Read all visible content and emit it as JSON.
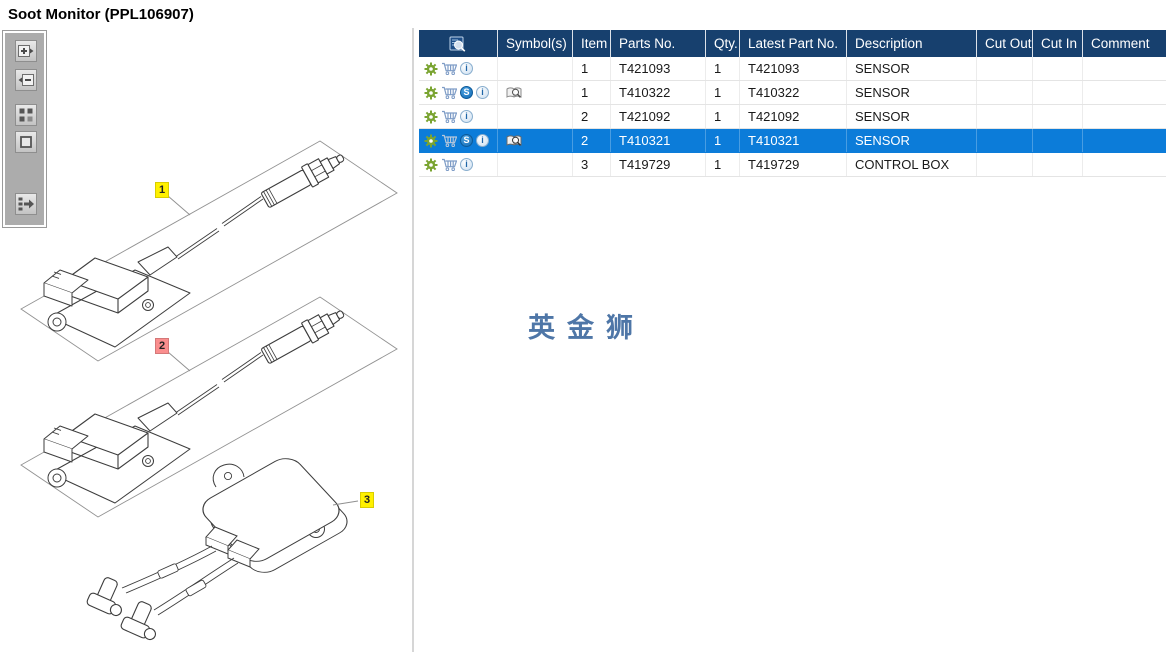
{
  "window": {
    "title": "Soot Monitor (PPL106907)"
  },
  "watermark": {
    "text": "英金狮",
    "color": "#4E76A7"
  },
  "toolbar": {
    "buttons": [
      {
        "name": "zoom-in"
      },
      {
        "name": "zoom-out"
      },
      {
        "name": "tile-view"
      },
      {
        "name": "fit-view"
      },
      {
        "name": "toggle-panel"
      }
    ]
  },
  "diagram": {
    "labels": [
      {
        "text": "1",
        "highlight": "#FFF100",
        "state": "normal"
      },
      {
        "text": "2",
        "highlight": "#FA8E8E",
        "state": "selected"
      },
      {
        "text": "3",
        "highlight": "#FFF100",
        "state": "normal"
      }
    ]
  },
  "table": {
    "columns": [
      "",
      "Symbol(s)",
      "Item",
      "Parts No.",
      "Qty.",
      "Latest Part No.",
      "Description",
      "Cut Out",
      "Cut In",
      "Comment"
    ],
    "icon_labels": {
      "substitute": "S",
      "info": "i"
    },
    "selected_row_index": 3,
    "rows": [
      {
        "item": "1",
        "parts_no": "T421093",
        "qty": "1",
        "latest_part_no": "T421093",
        "description": "SENSOR",
        "cut_out": "",
        "cut_in": "",
        "comment": "",
        "has_substitute": false,
        "has_symbol": false,
        "selected": false
      },
      {
        "item": "1",
        "parts_no": "T410322",
        "qty": "1",
        "latest_part_no": "T410322",
        "description": "SENSOR",
        "cut_out": "",
        "cut_in": "",
        "comment": "",
        "has_substitute": true,
        "has_symbol": true,
        "selected": false
      },
      {
        "item": "2",
        "parts_no": "T421092",
        "qty": "1",
        "latest_part_no": "T421092",
        "description": "SENSOR",
        "cut_out": "",
        "cut_in": "",
        "comment": "",
        "has_substitute": false,
        "has_symbol": false,
        "selected": false
      },
      {
        "item": "2",
        "parts_no": "T410321",
        "qty": "1",
        "latest_part_no": "T410321",
        "description": "SENSOR",
        "cut_out": "",
        "cut_in": "",
        "comment": "",
        "has_substitute": true,
        "has_symbol": true,
        "selected": true
      },
      {
        "item": "3",
        "parts_no": "T419729",
        "qty": "1",
        "latest_part_no": "T419729",
        "description": "CONTROL BOX",
        "cut_out": "",
        "cut_in": "",
        "comment": "",
        "has_substitute": false,
        "has_symbol": false,
        "selected": false
      }
    ]
  },
  "colors": {
    "header_bg": "#17406E",
    "selected_row_bg": "#0C7CD9",
    "gear_icon": "#7AA431",
    "cart_icon": "#7E9CC6",
    "substitute_badge": "#1273C4"
  }
}
